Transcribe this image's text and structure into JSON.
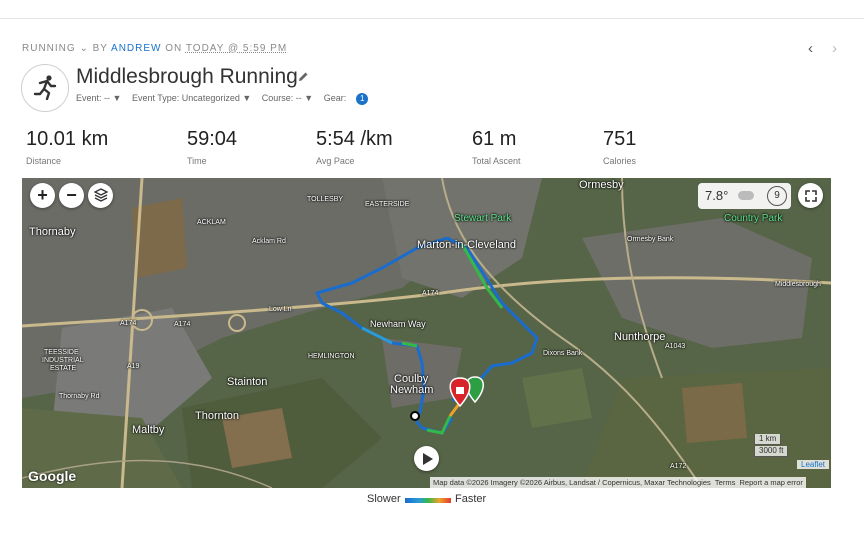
{
  "header": {
    "activity_type": "RUNNING",
    "by": "BY",
    "author": "ANDREW",
    "on": "ON",
    "date": "TODAY @ 5:59 PM"
  },
  "activity": {
    "title": "Middlesbrough Running",
    "icon": "runner-icon",
    "attributes": {
      "event": "Event: -- ▼",
      "event_type": "Event Type: Uncategorized ▼",
      "course": "Course: -- ▼",
      "gear_label": "Gear:",
      "gear_count": "1"
    }
  },
  "stats": [
    {
      "value": "10.01 km",
      "label": "Distance"
    },
    {
      "value": "59:04",
      "label": "Time"
    },
    {
      "value": "5:54 /km",
      "label": "Avg Pace"
    },
    {
      "value": "61 m",
      "label": "Total Ascent"
    },
    {
      "value": "751",
      "label": "Calories"
    }
  ],
  "map": {
    "weather_temp": "7.8°",
    "wind_speed": "9",
    "labels": {
      "ormesby": "Ormesby",
      "tollesby": "TOLLESBY",
      "easterside": "EASTERSIDE",
      "stewart_park": "Stewart Park",
      "country_park": "Country Park",
      "thornaby": "Thornaby",
      "acklam": "ACKLAM",
      "marton": "Marton-in-Cleveland",
      "acklam_rd": "Acklam Rd",
      "a174_1": "A174",
      "a174_2": "A174",
      "a174_3": "A174",
      "low_ln": "Low Ln",
      "newham_way": "Newham Way",
      "middlesbrough": "Middlesbrough",
      "nunthorpe": "Nunthorpe",
      "dixons_bank": "Dixons Bank",
      "hemlington": "HEMLINGTON",
      "teesside": "TEESSIDE",
      "industrial": "INDUSTRIAL",
      "estate": "ESTATE",
      "stainton": "Stainton",
      "coulby": "Coulby",
      "newham": "Newham",
      "thornton": "Thornton",
      "maltby": "Maltby",
      "a1043": "A1043",
      "a19": "A19",
      "a172": "A172",
      "ormesby_bank": "Ormesby Bank",
      "thornaby_rd": "Thornaby Rd"
    },
    "scale_km": "1 km",
    "scale_ft": "3000 ft",
    "leaflet": "Leaflet",
    "google": "Google",
    "attribution": "Map data ©2026 Imagery ©2026 Airbus, Landsat / Copernicus, Maxar Technologies",
    "terms": "Terms",
    "report": "Report a map error"
  },
  "legend": {
    "slower": "Slower",
    "faster": "Faster"
  }
}
